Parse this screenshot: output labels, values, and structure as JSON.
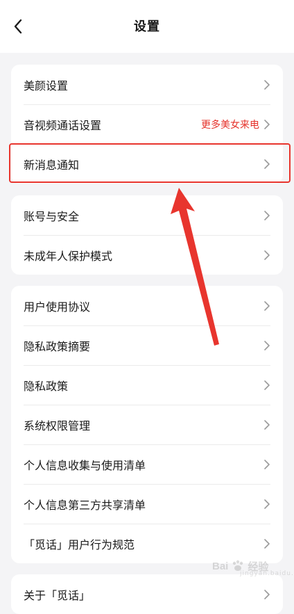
{
  "header": {
    "title": "设置"
  },
  "groups": [
    {
      "items": [
        {
          "label": "美颜设置"
        },
        {
          "label": "音视频通话设置",
          "extra": "更多美女来电"
        },
        {
          "label": "新消息通知"
        }
      ]
    },
    {
      "items": [
        {
          "label": "账号与安全"
        },
        {
          "label": "未成年人保护模式"
        }
      ]
    },
    {
      "items": [
        {
          "label": "用户使用协议"
        },
        {
          "label": "隐私政策摘要"
        },
        {
          "label": "隐私政策"
        },
        {
          "label": "系统权限管理"
        },
        {
          "label": "个人信息收集与使用清单"
        },
        {
          "label": "个人信息第三方共享清单"
        },
        {
          "label": "「觅话」用户行为规范"
        }
      ]
    },
    {
      "items": [
        {
          "label": "关于「觅话」"
        }
      ]
    }
  ],
  "colors": {
    "accent_red": "#e5312a",
    "background": "#f4f4f6"
  },
  "watermark": {
    "text": "Bai",
    "text2": "经验",
    "sub": "jingyan.baidu.com"
  },
  "icons": {
    "back": "chevron-left-icon",
    "row": "chevron-right-icon"
  }
}
